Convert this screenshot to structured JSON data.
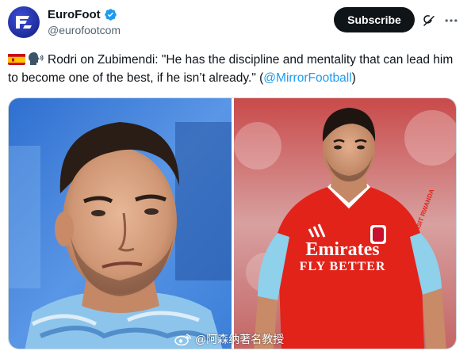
{
  "account": {
    "display_name": "EuroFoot",
    "handle": "@eurofootcom",
    "avatar_icon": "eurofoot-logo",
    "verified": true
  },
  "actions": {
    "subscribe_label": "Subscribe",
    "grok_icon": "grok-icon",
    "more_icon": "more-icon"
  },
  "tweet": {
    "emoji_flag": "spain-flag",
    "emoji_speaker": "speaking-head",
    "text": "Rodri on Zubimendi: \"He has the discipline and mentality that can lead him to become one of the best, if he isn’t already.\" (",
    "mention": "@MirrorFootball",
    "text_end": ")"
  },
  "media": {
    "left_photo": "rodri-portrait",
    "right_photo": "zubimendi-arsenal-kit",
    "jersey_sponsor_line1": "Emirates",
    "jersey_sponsor_line2": "FLY BETTER",
    "jersey_sleeve_text": "VISIT RWANDA",
    "watermark_text": "@阿森纳著名教授"
  },
  "colors": {
    "accent": "#1d9bf0",
    "button_bg": "#0f1419",
    "arsenal_red": "#e2231a",
    "city_blue": "#6cabdd"
  }
}
